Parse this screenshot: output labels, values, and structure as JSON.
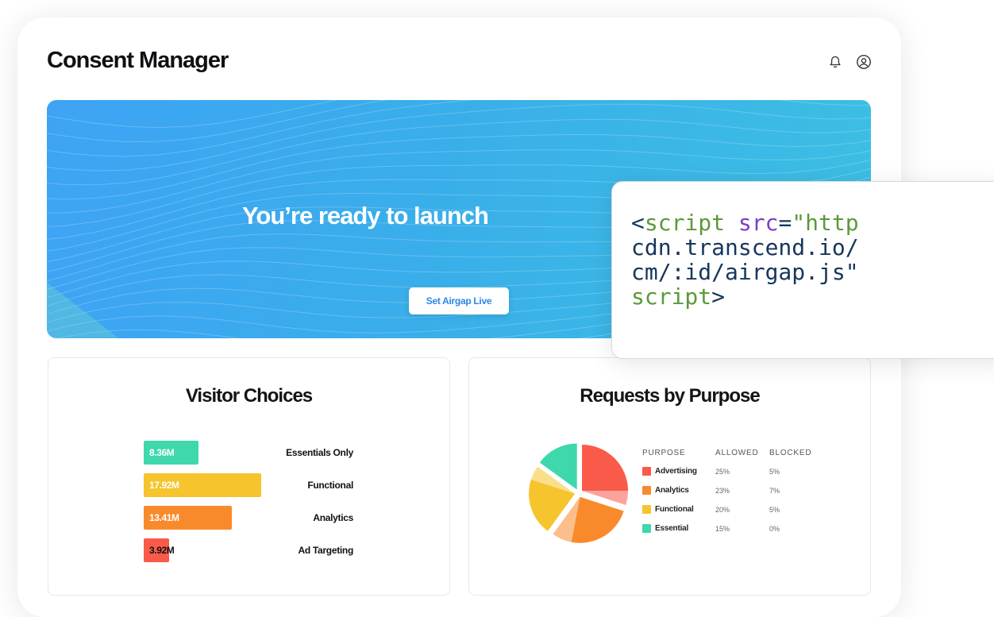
{
  "app": {
    "title": "Consent Manager"
  },
  "header": {
    "icons": [
      "bell-icon",
      "user-circle-icon"
    ]
  },
  "hero": {
    "title": "You’re ready to launch",
    "button_label": "Set Airgap Live",
    "gradient": [
      "#3ea3f5",
      "#3cbfe3"
    ]
  },
  "code": {
    "lines": [
      [
        {
          "t": "<",
          "c": "punc"
        },
        {
          "t": "script",
          "c": "tag"
        },
        {
          "t": " ",
          "c": "punc"
        },
        {
          "t": "src",
          "c": "attr"
        },
        {
          "t": "=",
          "c": "punc"
        },
        {
          "t": "\"http",
          "c": "str"
        }
      ],
      [
        {
          "t": "cdn.transcend.io/",
          "c": "punc"
        }
      ],
      [
        {
          "t": "cm/:id/airgap.js\"",
          "c": "punc"
        }
      ],
      [
        {
          "t": "script",
          "c": "tag"
        },
        {
          "t": ">",
          "c": "punc"
        }
      ]
    ]
  },
  "visitor_choices": {
    "title": "Visitor Choices",
    "bars": [
      {
        "value_label": "8.36M",
        "value": 8.36,
        "label": "Essentials Only",
        "color": "#3ed8ac",
        "text_color": "#ffffff"
      },
      {
        "value_label": "17.92M",
        "value": 17.92,
        "label": "Functional",
        "color": "#f6c42c",
        "text_color": "#ffffff"
      },
      {
        "value_label": "13.41M",
        "value": 13.41,
        "label": "Analytics",
        "color": "#f98a2c",
        "text_color": "#ffffff"
      },
      {
        "value_label": "3.92M",
        "value": 3.92,
        "label": "Ad Targeting",
        "color": "#fa5a49",
        "text_color": "#111111"
      }
    ]
  },
  "requests_by_purpose": {
    "title": "Requests by Purpose",
    "columns": [
      "PURPOSE",
      "ALLOWED",
      "BLOCKED"
    ],
    "rows": [
      {
        "name": "Advertising",
        "allowed": "25%",
        "blocked": "5%",
        "color": "#fa5a49"
      },
      {
        "name": "Analytics",
        "allowed": "23%",
        "blocked": "7%",
        "color": "#f98a2c"
      },
      {
        "name": "Functional",
        "allowed": "20%",
        "blocked": "5%",
        "color": "#f6c42c"
      },
      {
        "name": "Essential",
        "allowed": "15%",
        "blocked": "0%",
        "color": "#3ed8ac"
      }
    ]
  },
  "chart_data": [
    {
      "type": "bar",
      "title": "Visitor Choices",
      "categories": [
        "Essentials Only",
        "Functional",
        "Analytics",
        "Ad Targeting"
      ],
      "values": [
        8.36,
        17.92,
        13.41,
        3.92
      ],
      "value_labels": [
        "8.36M",
        "17.92M",
        "13.41M",
        "3.92M"
      ],
      "orientation": "horizontal"
    },
    {
      "type": "pie",
      "title": "Requests by Purpose",
      "categories": [
        "Advertising",
        "Analytics",
        "Functional",
        "Essential"
      ],
      "series": [
        {
          "values": [
            25,
            23,
            20,
            15
          ]
        },
        {
          "values": [
            5,
            7,
            5,
            0
          ]
        }
      ],
      "colors": [
        "#fa5a49",
        "#f98a2c",
        "#f6c42c",
        "#3ed8ac"
      ]
    }
  ]
}
